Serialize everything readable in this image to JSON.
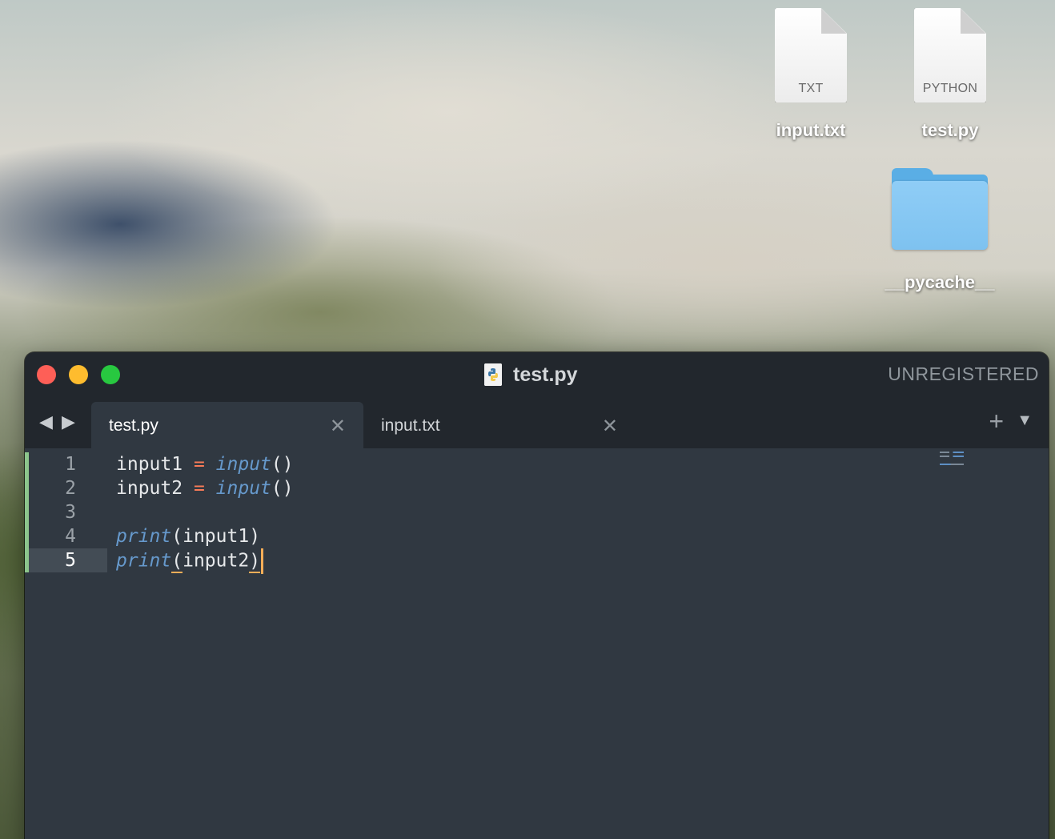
{
  "desktop": {
    "icons": [
      {
        "label": "input.txt",
        "type_label": "TXT"
      },
      {
        "label": "test.py",
        "type_label": "PYTHON"
      },
      {
        "label": "__pycache__"
      }
    ]
  },
  "window": {
    "title": "test.py",
    "license_status": "UNREGISTERED",
    "nav": {
      "back_icon": "triangle-left-icon",
      "forward_icon": "triangle-right-icon"
    },
    "tabs": [
      {
        "label": "test.py",
        "active": true,
        "close_glyph": "✕"
      },
      {
        "label": "input.txt",
        "active": false,
        "close_glyph": "✕"
      }
    ],
    "new_tab_glyph": "+",
    "tab_menu_glyph": "▼"
  },
  "editor": {
    "line_numbers": [
      "1",
      "2",
      "3",
      "4",
      "5"
    ],
    "current_line": 5,
    "lines": [
      {
        "var": "input1",
        "op": "=",
        "func": "input",
        "args": "()"
      },
      {
        "var": "input2",
        "op": "=",
        "func": "input",
        "args": "()"
      },
      {},
      {
        "func": "print",
        "open": "(",
        "arg": "input1",
        "close": ")"
      },
      {
        "func": "print",
        "open": "(",
        "arg": "input2",
        "close": ")"
      }
    ]
  },
  "colors": {
    "editor_bg": "#303841",
    "titlebar_bg": "#22272d",
    "close": "#fe5f57",
    "minimize": "#febc2e",
    "zoom": "#28c840",
    "function": "#6699cc",
    "operator": "#f97b58",
    "caret": "#f9ae58",
    "modified_gutter": "#8cc58c",
    "folder": "#7ec2f0"
  }
}
